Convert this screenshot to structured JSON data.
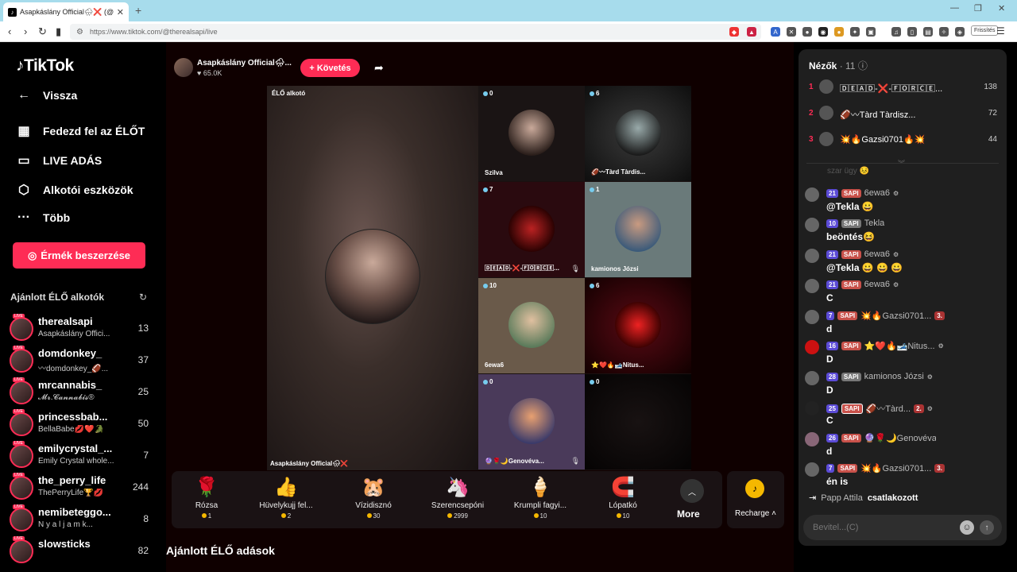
{
  "browser": {
    "tab_title": "Asapkáslány Official🌧❌ (@",
    "url": "https://www.tiktok.com/@therealsapi/live",
    "refresh_label": "Frissítés"
  },
  "sidebar": {
    "logo": "TikTok",
    "nav": [
      {
        "label": "Vissza"
      },
      {
        "label": "Fedezd fel az ÉLŐT"
      },
      {
        "label": "LIVE ADÁS"
      },
      {
        "label": "Alkotói eszközök"
      },
      {
        "label": "Több"
      }
    ],
    "buy_coins": "Érmék beszerzése",
    "recommended_title": "Ajánlott ÉLŐ alkotók",
    "creators": [
      {
        "name": "therealsapi",
        "sub": "Asapkáslány Offici...",
        "count": "13"
      },
      {
        "name": "domdonkey_",
        "sub": "〰domdonkey_🏈...",
        "count": "37"
      },
      {
        "name": "mrcannabis_",
        "sub": "𝓜𝓻.𝓒𝓪𝓷𝓷𝓪𝓫𝓲𝓼®",
        "count": "25"
      },
      {
        "name": "princessbab...",
        "sub": "BellaBabe💋❤️🐊",
        "count": "50"
      },
      {
        "name": "emilycrystal_...",
        "sub": "Emily Crystal whole...",
        "count": "7"
      },
      {
        "name": "the_perry_life",
        "sub": "ThePerryLife🏆💋",
        "count": "244"
      },
      {
        "name": "nemibeteggo...",
        "sub": "N y a l j a m k...",
        "count": "8"
      },
      {
        "name": "slowsticks",
        "sub": "",
        "count": "82"
      }
    ]
  },
  "stream": {
    "host_name": "Asapkáslány Official🌧...",
    "host_likes": "65.0K",
    "follow": "+ Követés",
    "host_tag": "ÉLŐ alkotó",
    "host_bottom": "Asapkáslány Official🌧❌",
    "guests": [
      {
        "count": "0",
        "label": "Szilva"
      },
      {
        "count": "6",
        "label": "🏈〰Tàrd Tàrdis..."
      },
      {
        "count": "7",
        "label": "🄳🄴🄰🄳-❌-🄵🄾🅁🄲🄴..."
      },
      {
        "count": "1",
        "label": "kamionos Józsi"
      },
      {
        "count": "10",
        "label": "6ewa6"
      },
      {
        "count": "6",
        "label": "⭐❤️🔥🎿Nitus..."
      },
      {
        "count": "0",
        "label": "🔮🌹🌙Genovéva..."
      },
      {
        "count": "0",
        "label": ""
      }
    ],
    "gifts": [
      {
        "name": "Rózsa",
        "price": "1",
        "icon": "🌹"
      },
      {
        "name": "Hüvelykujj fel...",
        "price": "2",
        "icon": "👍"
      },
      {
        "name": "Vízidisznó",
        "price": "30",
        "icon": "🐹"
      },
      {
        "name": "Szerencsepóni",
        "price": "2999",
        "icon": "🦄"
      },
      {
        "name": "Krumpli fagyi...",
        "price": "10",
        "icon": "🍦"
      },
      {
        "name": "Lópatkó",
        "price": "10",
        "icon": "🧲"
      }
    ],
    "more": "More",
    "recharge": "Recharge",
    "recommended_live": "Ajánlott ÉLŐ adások"
  },
  "panel": {
    "viewers_label": "Nézők",
    "viewers_count": "· 11",
    "top_viewers": [
      {
        "rank": "1",
        "name": "🄳🄴🄰🄳-❌-🄵🄾🅁🄲🄴...",
        "score": "138"
      },
      {
        "rank": "2",
        "name": "🏈〰Tàrd Tàrdisz...",
        "score": "72"
      },
      {
        "rank": "3",
        "name": "💥🔥Gazsi0701🔥💥",
        "score": "44"
      }
    ],
    "faded_text": "szar ügy 😣",
    "messages": [
      {
        "lvl": "21",
        "sapi": "SAPI",
        "user": "6ewa6",
        "rank": "",
        "text": "@Tekla 😀"
      },
      {
        "lvl": "10",
        "sapi": "SAPI",
        "user": "Tekla",
        "rank": "",
        "text": "beöntés😆"
      },
      {
        "lvl": "21",
        "sapi": "SAPI",
        "user": "6ewa6",
        "rank": "",
        "text": "@Tekla 😀 😀 😀"
      },
      {
        "lvl": "21",
        "sapi": "SAPI",
        "user": "6ewa6",
        "rank": "",
        "text": "C"
      },
      {
        "lvl": "7",
        "sapi": "SAPI",
        "user": "💥🔥Gazsi0701...",
        "rank": "3.",
        "text": "d"
      },
      {
        "lvl": "16",
        "sapi": "SAPI",
        "user": "⭐❤️🔥🎿Nitus...",
        "rank": "",
        "text": "D"
      },
      {
        "lvl": "28",
        "sapi": "SAPI",
        "user": "kamionos Józsi",
        "rank": "",
        "text": "D"
      },
      {
        "lvl": "25",
        "sapi": "SAPI",
        "user": "🏈〰Tàrd...",
        "rank": "2.",
        "text": "C"
      },
      {
        "lvl": "26",
        "sapi": "SAPI",
        "user": "🔮🌹🌙Genovéva...",
        "rank": "",
        "text": "d"
      },
      {
        "lvl": "7",
        "sapi": "SAPI",
        "user": "💥🔥Gazsi0701...",
        "rank": "3.",
        "text": "én is"
      }
    ],
    "joined_user": "Papp Attila",
    "joined_action": "csatlakozott",
    "input_placeholder": "Bevitel...(C)"
  }
}
